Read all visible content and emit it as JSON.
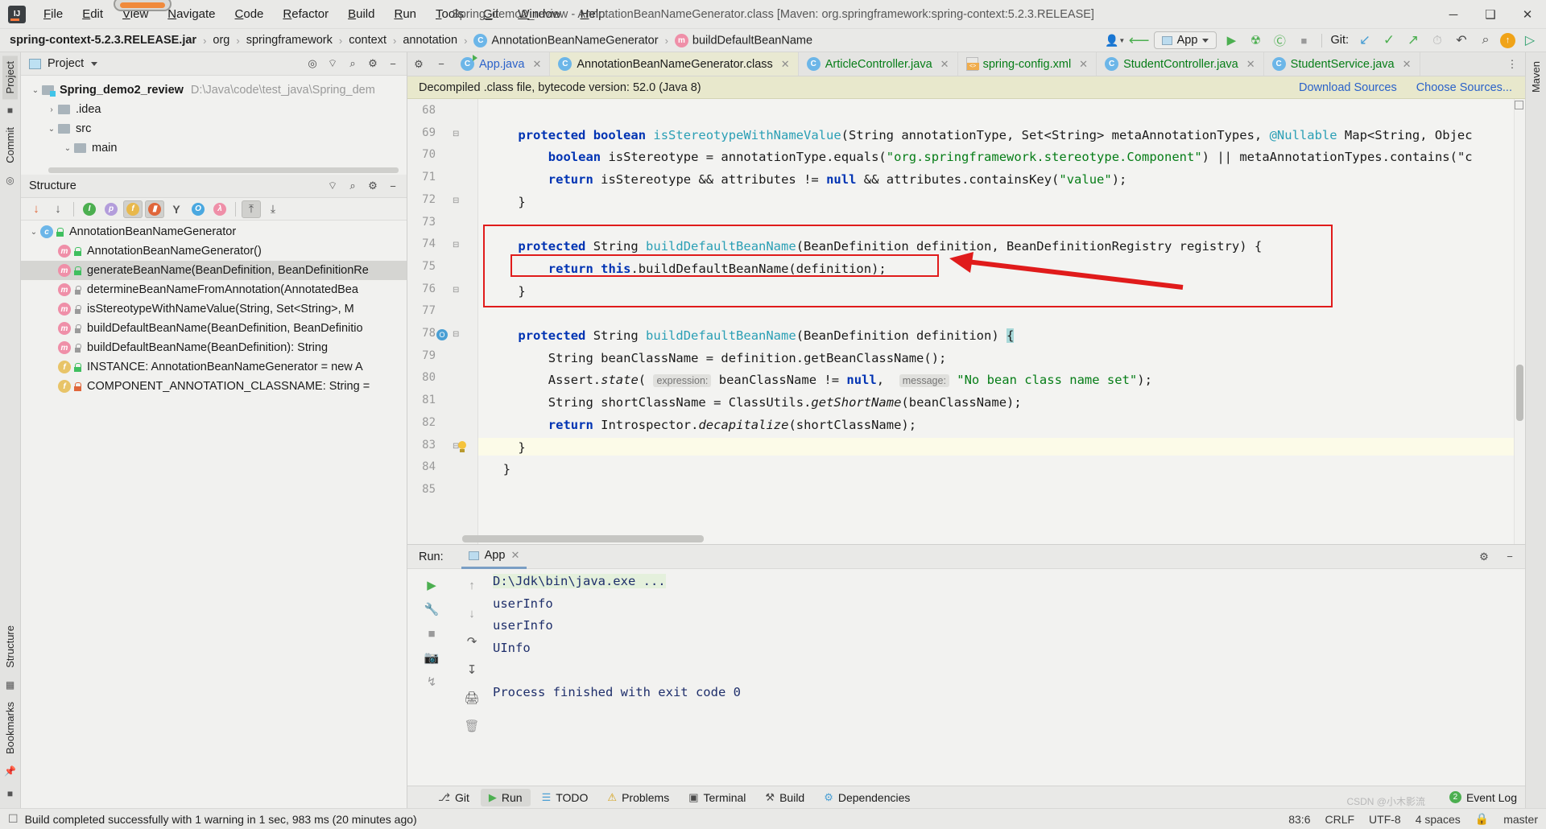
{
  "window": {
    "title": "Spring_demo2_review - AnnotationBeanNameGenerator.class [Maven: org.springframework:spring-context:5.2.3.RELEASE]",
    "minimize": "─",
    "maximize": "❑",
    "close": "✕",
    "logo_text": "IJ"
  },
  "menu": {
    "items": [
      {
        "label": "File",
        "u": "F",
        "rest": "ile"
      },
      {
        "label": "Edit",
        "u": "E",
        "rest": "dit"
      },
      {
        "label": "View",
        "u": "V",
        "rest": "iew"
      },
      {
        "label": "Navigate",
        "u": "N",
        "rest": "avigate"
      },
      {
        "label": "Code",
        "u": "C",
        "rest": "ode"
      },
      {
        "label": "Refactor",
        "u": "R",
        "rest": "efactor"
      },
      {
        "label": "Build",
        "u": "B",
        "rest": "uild"
      },
      {
        "label": "Run",
        "u": "R",
        "rest": "un"
      },
      {
        "label": "Tools",
        "u": "T",
        "rest": "ools"
      },
      {
        "label": "Git",
        "u": "G",
        "rest": "it"
      },
      {
        "label": "Window",
        "u": "W",
        "rest": "indow"
      },
      {
        "label": "Help",
        "u": "H",
        "rest": "elp"
      }
    ]
  },
  "breadcrumb": {
    "items": [
      {
        "label": "spring-context-5.2.3.RELEASE.jar",
        "bold": true,
        "icon": ""
      },
      {
        "label": "org",
        "bold": false,
        "icon": ""
      },
      {
        "label": "springframework",
        "bold": false,
        "icon": ""
      },
      {
        "label": "context",
        "bold": false,
        "icon": ""
      },
      {
        "label": "annotation",
        "bold": false,
        "icon": ""
      },
      {
        "label": "AnnotationBeanNameGenerator",
        "bold": false,
        "icon": "c"
      },
      {
        "label": "buildDefaultBeanName",
        "bold": false,
        "icon": "m"
      }
    ],
    "separator": "›"
  },
  "toolbar": {
    "run_config": "App",
    "git_label": "Git:",
    "icons": {
      "user": "user-icon",
      "back": "back-arrow-icon",
      "run": "▶",
      "debug": "☢",
      "coverage": "Ⓒ",
      "stop": "■",
      "update": "↙",
      "commit": "✓",
      "push": "↗",
      "history": "⏱",
      "revert": "↶",
      "search": "⌕"
    }
  },
  "project_panel": {
    "title": "Project",
    "header_icons": [
      "locate-icon",
      "collapse-all-icon",
      "expand-icon",
      "settings-icon",
      "hide-icon"
    ],
    "tree": [
      {
        "label": "Spring_demo2_review",
        "path": "D:\\Java\\code\\test_java\\Spring_dem",
        "depth": 0,
        "arrow": "⌄",
        "bold": true,
        "type": "project"
      },
      {
        "label": ".idea",
        "path": "",
        "depth": 1,
        "arrow": "›",
        "bold": false,
        "type": "folder"
      },
      {
        "label": "src",
        "path": "",
        "depth": 1,
        "arrow": "⌄",
        "bold": false,
        "type": "folder"
      },
      {
        "label": "main",
        "path": "",
        "depth": 2,
        "arrow": "⌄",
        "bold": false,
        "type": "folder"
      }
    ]
  },
  "structure_panel": {
    "title": "Structure",
    "toolbar_icons": [
      {
        "name": "sort-by-visibility-icon",
        "glyph": "↓",
        "color": "#e0663a"
      },
      {
        "name": "sort-alphabetically-icon",
        "glyph": "↓",
        "color": "#555555"
      },
      {
        "name": "show-inherited-icon",
        "glyph": "I",
        "color": "#4caf50"
      },
      {
        "name": "show-properties-icon",
        "glyph": "p",
        "color": "#b39ddb"
      },
      {
        "name": "show-fields-icon",
        "glyph": "f",
        "color": "#e8b84b"
      },
      {
        "name": "show-non-public-icon",
        "glyph": "▮",
        "color": "#e0663a"
      },
      {
        "name": "group-methods-icon",
        "glyph": "Y",
        "color": "#555555"
      },
      {
        "name": "show-anonymous-icon",
        "glyph": "O",
        "color": "#4aa8e0"
      },
      {
        "name": "show-lambdas-icon",
        "glyph": "λ",
        "color": "#ef8fa8"
      },
      {
        "name": "expand-all-icon",
        "glyph": "⤒",
        "color": "#555555"
      },
      {
        "name": "collapse-all-icon",
        "glyph": "⤓",
        "color": "#555555"
      }
    ],
    "tree": [
      {
        "label": "AnnotationBeanNameGenerator",
        "kind": "c",
        "vis": "pub",
        "depth": 0,
        "arrow": "⌄",
        "selected": false
      },
      {
        "label": "AnnotationBeanNameGenerator()",
        "kind": "m",
        "vis": "pub",
        "depth": 1,
        "arrow": "",
        "selected": false
      },
      {
        "label": "generateBeanName(BeanDefinition, BeanDefinitionRe",
        "kind": "m",
        "vis": "pub",
        "depth": 1,
        "arrow": "",
        "selected": true
      },
      {
        "label": "determineBeanNameFromAnnotation(AnnotatedBea",
        "kind": "m",
        "vis": "prot",
        "depth": 1,
        "arrow": "",
        "selected": false
      },
      {
        "label": "isStereotypeWithNameValue(String, Set<String>, M",
        "kind": "m",
        "vis": "prot",
        "depth": 1,
        "arrow": "",
        "selected": false
      },
      {
        "label": "buildDefaultBeanName(BeanDefinition, BeanDefinitio",
        "kind": "m",
        "vis": "prot",
        "depth": 1,
        "arrow": "",
        "selected": false
      },
      {
        "label": "buildDefaultBeanName(BeanDefinition): String",
        "kind": "m",
        "vis": "prot",
        "depth": 1,
        "arrow": "",
        "selected": false
      },
      {
        "label": "INSTANCE: AnnotationBeanNameGenerator = new A",
        "kind": "f",
        "vis": "pub",
        "depth": 1,
        "arrow": "",
        "selected": false
      },
      {
        "label": "COMPONENT_ANNOTATION_CLASSNAME: String =",
        "kind": "f",
        "vis": "priv",
        "depth": 1,
        "arrow": "",
        "selected": false
      }
    ]
  },
  "left_strip": {
    "tabs": [
      "Project",
      "Commit",
      "Structure",
      "Bookmarks"
    ]
  },
  "right_strip": {
    "tabs": [
      "Maven"
    ]
  },
  "editor": {
    "tabs": [
      {
        "label": "App.java",
        "icon": "java-run-icon",
        "color": "#2b62c9",
        "active": false
      },
      {
        "label": "AnnotationBeanNameGenerator.class",
        "icon": "class-icon",
        "color": "#1a1a1a",
        "active": true
      },
      {
        "label": "ArticleController.java",
        "icon": "java-icon",
        "color": "#067d17",
        "active": false
      },
      {
        "label": "spring-config.xml",
        "icon": "xml-icon",
        "color": "#067d17",
        "active": false
      },
      {
        "label": "StudentController.java",
        "icon": "java-icon",
        "color": "#067d17",
        "active": false
      },
      {
        "label": "StudentService.java",
        "icon": "java-icon",
        "color": "#067d17",
        "active": false
      }
    ],
    "close_glyph": "✕",
    "notification": {
      "text": "Decompiled .class file, bytecode version: 52.0 (Java 8)",
      "links": [
        "Download Sources",
        "Choose Sources..."
      ]
    },
    "line_numbers": [
      68,
      69,
      70,
      71,
      72,
      73,
      74,
      75,
      76,
      77,
      78,
      79,
      80,
      81,
      82,
      83,
      84,
      85
    ],
    "code_lines": [
      {
        "num": 69,
        "indent": 4,
        "tokens": [
          {
            "t": "protected ",
            "c": "k"
          },
          {
            "t": "boolean ",
            "c": "k"
          },
          {
            "t": "isStereotypeWithNameValue",
            "c": "m"
          },
          {
            "t": "(String annotationType, Set<String> metaAnnotationTypes, ",
            "c": "n"
          },
          {
            "t": "@Nullable",
            "c": "m"
          },
          {
            "t": " Map<String, Objec",
            "c": "n"
          }
        ]
      },
      {
        "num": 70,
        "indent": 8,
        "tokens": [
          {
            "t": "boolean ",
            "c": "k"
          },
          {
            "t": "isStereotype = annotationType.equals(",
            "c": "n"
          },
          {
            "t": "\"org.springframework.stereotype.Component\"",
            "c": "s"
          },
          {
            "t": ") || metaAnnotationTypes.contains(\"c",
            "c": "n"
          }
        ]
      },
      {
        "num": 71,
        "indent": 8,
        "tokens": [
          {
            "t": "return ",
            "c": "k"
          },
          {
            "t": "isStereotype && attributes != ",
            "c": "n"
          },
          {
            "t": "null",
            "c": "k"
          },
          {
            "t": " && attributes.containsKey(",
            "c": "n"
          },
          {
            "t": "\"value\"",
            "c": "s"
          },
          {
            "t": ");",
            "c": "n"
          }
        ]
      },
      {
        "num": 72,
        "indent": 4,
        "tokens": [
          {
            "t": "}",
            "c": "n"
          }
        ]
      },
      {
        "num": 74,
        "indent": 4,
        "tokens": [
          {
            "t": "protected ",
            "c": "k"
          },
          {
            "t": "String ",
            "c": "n"
          },
          {
            "t": "buildDefaultBeanName",
            "c": "m"
          },
          {
            "t": "(BeanDefinition definition, BeanDefinitionRegistry registry) {",
            "c": "n"
          }
        ]
      },
      {
        "num": 75,
        "indent": 8,
        "tokens": [
          {
            "t": "return ",
            "c": "k"
          },
          {
            "t": "this",
            "c": "k"
          },
          {
            "t": ".buildDefaultBeanName(definition);",
            "c": "n"
          }
        ]
      },
      {
        "num": 76,
        "indent": 4,
        "tokens": [
          {
            "t": "}",
            "c": "n"
          }
        ]
      },
      {
        "num": 78,
        "indent": 4,
        "tokens": [
          {
            "t": "protected ",
            "c": "k"
          },
          {
            "t": "String ",
            "c": "n"
          },
          {
            "t": "buildDefaultBeanName",
            "c": "m"
          },
          {
            "t": "(BeanDefinition definition) ",
            "c": "n"
          },
          {
            "t": "{",
            "c": "brace"
          }
        ]
      },
      {
        "num": 79,
        "indent": 8,
        "tokens": [
          {
            "t": "String beanClassName = definition.getBeanClassName();",
            "c": "n"
          }
        ]
      },
      {
        "num": 80,
        "indent": 8,
        "tokens": [
          {
            "t": "Assert.",
            "c": "n"
          },
          {
            "t": "state",
            "c": "i"
          },
          {
            "t": "( ",
            "c": "n"
          },
          {
            "t": "expression:",
            "c": "hint"
          },
          {
            "t": " beanClassName != ",
            "c": "n"
          },
          {
            "t": "null",
            "c": "k"
          },
          {
            "t": ",  ",
            "c": "n"
          },
          {
            "t": "message:",
            "c": "hint"
          },
          {
            "t": " ",
            "c": "n"
          },
          {
            "t": "\"No bean class name set\"",
            "c": "s"
          },
          {
            "t": ");",
            "c": "n"
          }
        ]
      },
      {
        "num": 81,
        "indent": 8,
        "tokens": [
          {
            "t": "String shortClassName = ClassUtils.",
            "c": "n"
          },
          {
            "t": "getShortName",
            "c": "i"
          },
          {
            "t": "(beanClassName);",
            "c": "n"
          }
        ]
      },
      {
        "num": 82,
        "indent": 8,
        "tokens": [
          {
            "t": "return ",
            "c": "k"
          },
          {
            "t": "Introspector.",
            "c": "n"
          },
          {
            "t": "decapitalize",
            "c": "i"
          },
          {
            "t": "(shortClassName);",
            "c": "n"
          }
        ]
      },
      {
        "num": 83,
        "indent": 4,
        "tokens": [
          {
            "t": "}",
            "c": "n"
          }
        ]
      },
      {
        "num": 84,
        "indent": 2,
        "tokens": [
          {
            "t": "}",
            "c": "n"
          }
        ]
      }
    ],
    "annotation": {
      "box_color": "#e01b1b",
      "arrow_color": "#e01b1b"
    }
  },
  "run_panel": {
    "label": "Run:",
    "tab": "App",
    "close_glyph": "✕",
    "side_icons": [
      "rerun-icon",
      "settings-wrench-icon",
      "stop-icon",
      "camera-icon",
      "thread-dump-icon"
    ],
    "side_icons2": [
      "scroll-up-icon",
      "scroll-down-icon",
      "soft-wrap-icon",
      "scroll-to-end-icon",
      "print-icon",
      "clear-all-icon"
    ],
    "console_lines": [
      {
        "text": "D:\\Jdk\\bin\\java.exe ...",
        "highlight": true
      },
      {
        "text": "userInfo",
        "highlight": false
      },
      {
        "text": "userInfo",
        "highlight": false
      },
      {
        "text": "UInfo",
        "highlight": false
      },
      {
        "text": "",
        "highlight": false
      },
      {
        "text": "Process finished with exit code 0",
        "highlight": false
      }
    ],
    "header_icons": [
      "settings-gear-icon",
      "hide-icon"
    ]
  },
  "bottom_toolbar": {
    "items": [
      {
        "label": "Git",
        "icon": "git-icon",
        "selected": false
      },
      {
        "label": "Run",
        "icon": "run-icon",
        "selected": true
      },
      {
        "label": "TODO",
        "icon": "todo-icon",
        "selected": false
      },
      {
        "label": "Problems",
        "icon": "problems-icon",
        "selected": false
      },
      {
        "label": "Terminal",
        "icon": "terminal-icon",
        "selected": false
      },
      {
        "label": "Build",
        "icon": "build-icon",
        "selected": false
      },
      {
        "label": "Dependencies",
        "icon": "dependencies-icon",
        "selected": false
      }
    ],
    "event_log": "Event Log"
  },
  "status_bar": {
    "message": "Build completed successfully with 1 warning in 1 sec, 983 ms (20 minutes ago)",
    "caret": "83:6",
    "line_sep": "CRLF",
    "encoding": "UTF-8",
    "indent": "4 spaces",
    "branch": "master",
    "lock_icon": "lock-icon"
  },
  "watermark": "CSDN @小木影流"
}
